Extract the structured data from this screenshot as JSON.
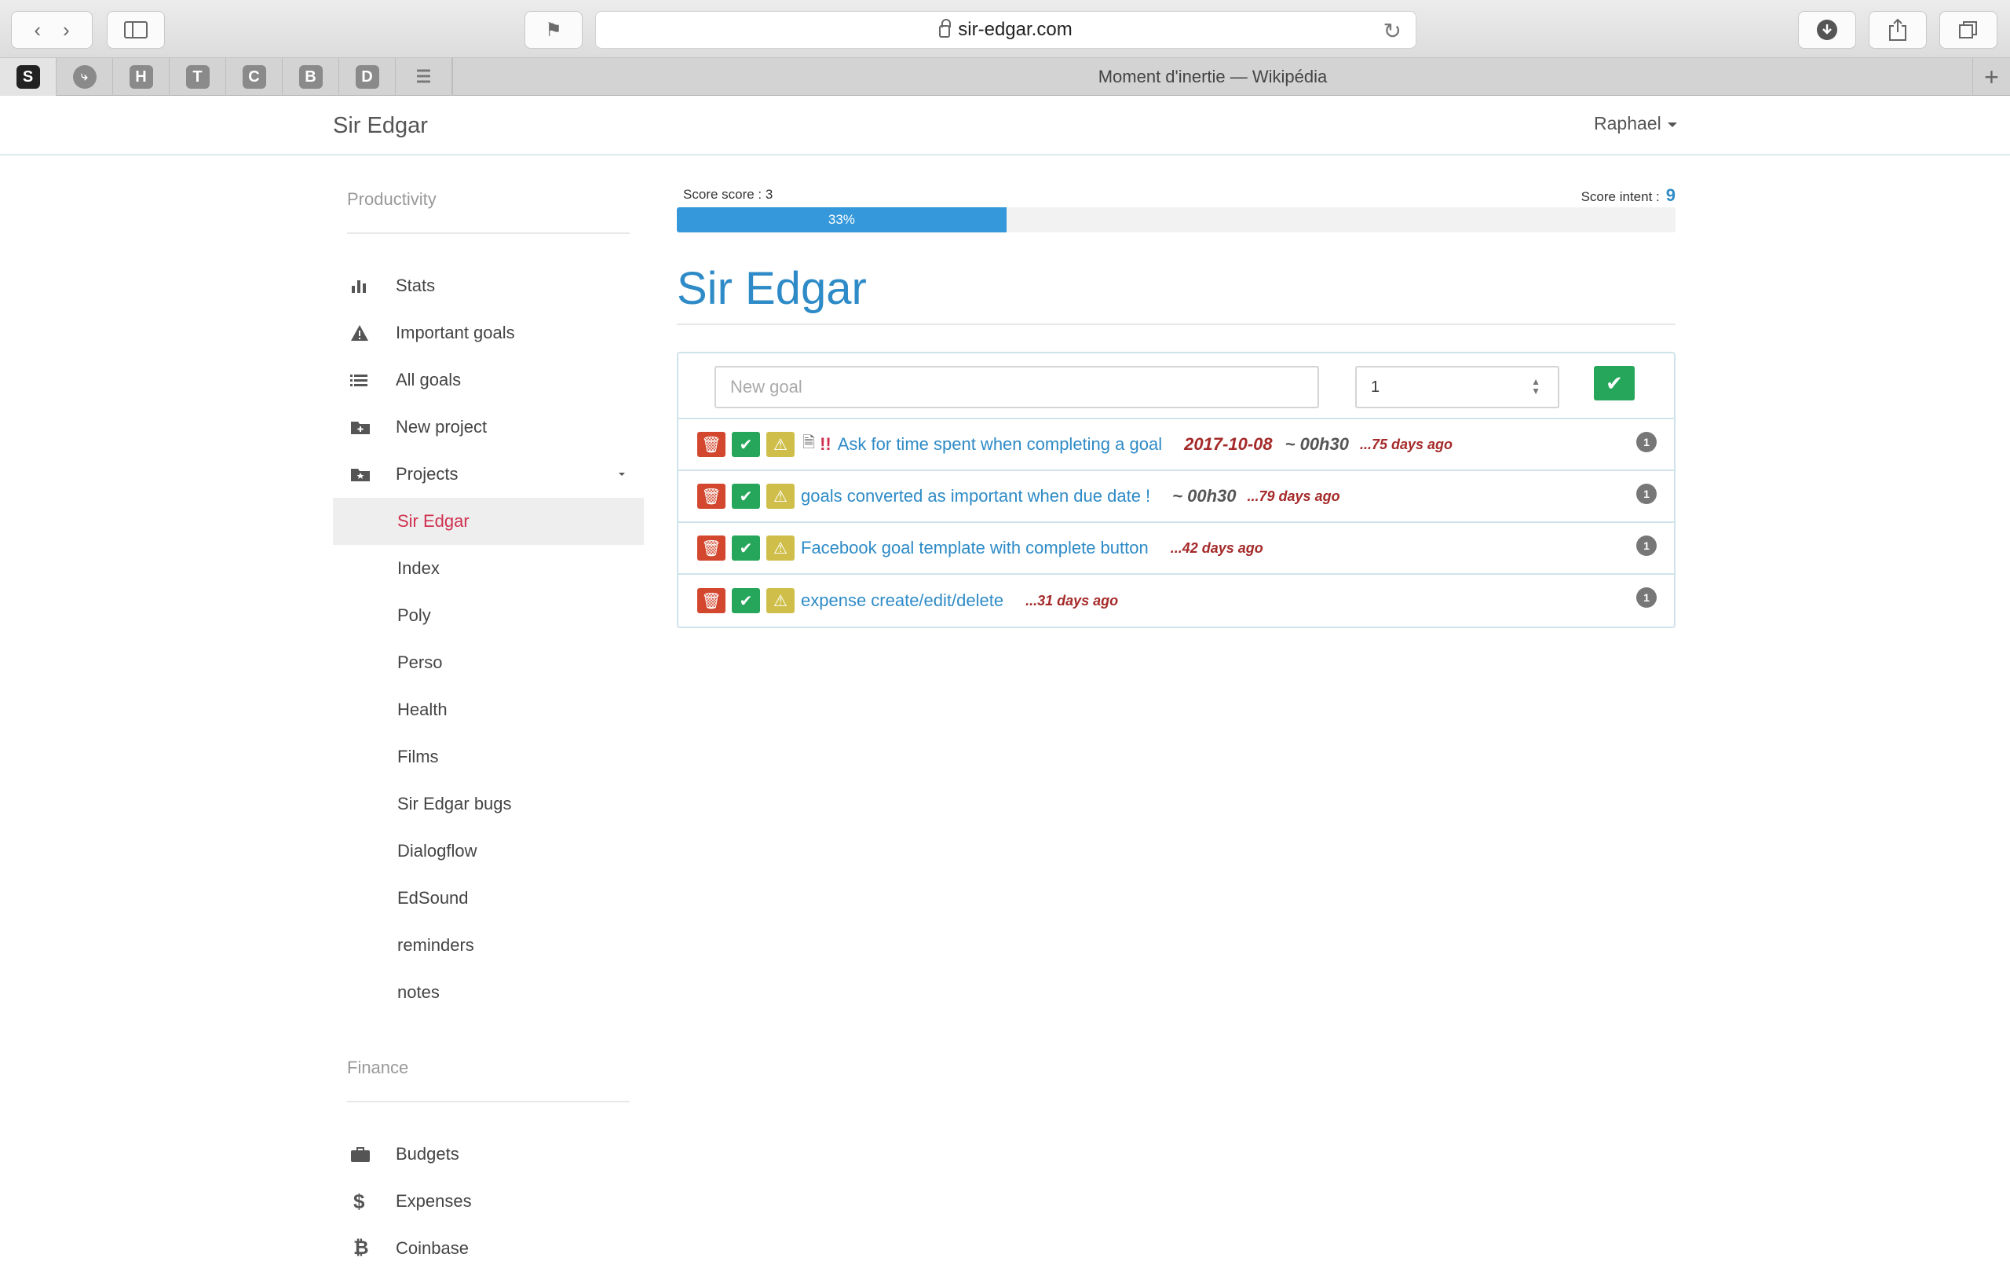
{
  "browser": {
    "url": "sir-edgar.com",
    "tab_title": "Moment d'inertie — Wikipédia",
    "pinned_tabs": [
      "S",
      "",
      "H",
      "T",
      "C",
      "B",
      "D",
      ""
    ]
  },
  "navbar": {
    "brand": "Sir Edgar",
    "user": "Raphael"
  },
  "sidebar": {
    "productivity_title": "Productivity",
    "items": [
      {
        "label": "Stats",
        "icon": "bar-chart-icon"
      },
      {
        "label": "Important goals",
        "icon": "warning-icon"
      },
      {
        "label": "All goals",
        "icon": "list-icon"
      },
      {
        "label": "New project",
        "icon": "folder-plus-icon"
      },
      {
        "label": "Projects",
        "icon": "folder-star-icon"
      }
    ],
    "projects": [
      "Sir Edgar",
      "Index",
      "Poly",
      "Perso",
      "Health",
      "Films",
      "Sir Edgar bugs",
      "Dialogflow",
      "EdSound",
      "reminders",
      "notes"
    ],
    "finance_title": "Finance",
    "finance_items": [
      {
        "label": "Budgets",
        "icon": "briefcase-icon"
      },
      {
        "label": "Expenses",
        "icon": "dollar-icon"
      },
      {
        "label": "Coinbase",
        "icon": "bitcoin-icon"
      }
    ]
  },
  "main": {
    "score_label": "Score score : 3",
    "score_intent_label": "Score intent :",
    "score_intent_value": "9",
    "progress": 0.33,
    "progress_label": "33%",
    "title": "Sir Edgar",
    "new_goal_placeholder": "New goal",
    "new_goal_value": "1",
    "goals": [
      {
        "bang": "!!",
        "text": "Ask for time spent when completing a goal",
        "due": "2017-10-08",
        "time": "~ 00h30",
        "ago": "...75 days ago",
        "count": "1"
      },
      {
        "text": "goals converted as important when due date !",
        "time": "~ 00h30",
        "ago": "...79 days ago",
        "count": "1"
      },
      {
        "text": "Facebook goal template with complete button",
        "ago": "...42 days ago",
        "count": "1"
      },
      {
        "text": "expense create/edit/delete",
        "ago": "...31 days ago",
        "count": "1"
      }
    ]
  },
  "colors": {
    "accent": "#2e8bc7",
    "danger": "#d3472f",
    "success": "#26a65b",
    "warning": "#cfbf4a",
    "active_project": "#d0304f"
  }
}
